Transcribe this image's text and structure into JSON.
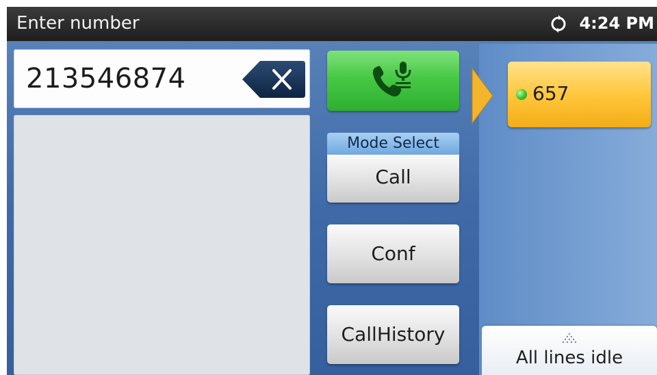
{
  "status_bar": {
    "title": "Enter number",
    "sync_icon": "sync-icon",
    "time": "4:24 PM"
  },
  "dialer": {
    "number_value": "213546874",
    "backspace_icon": "backspace-icon"
  },
  "actions": {
    "dial_icon": "phone-speaker-icon",
    "mode_select_label": "Mode Select",
    "mode_value": "Call",
    "conf_label": "Conf",
    "history_label": "CallHistory"
  },
  "lines": {
    "active_line": "657",
    "status_color": "#38c22d",
    "idle_label": "All lines idle",
    "expand_icon": "expand-up-icon"
  },
  "colors": {
    "dial_green": "#47c845",
    "line_amber": "#ffc73e",
    "mode_blue": "#6fa8e0"
  }
}
